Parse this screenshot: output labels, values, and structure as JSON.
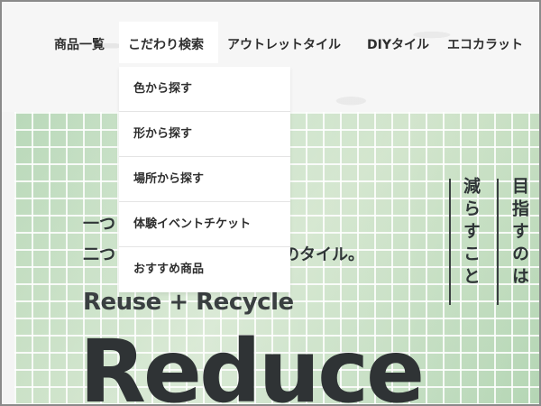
{
  "nav": {
    "items": [
      "商品一覧",
      "こだわり検索",
      "アウトレットタイル",
      "DIYタイル",
      "エコカラット"
    ]
  },
  "dropdown": {
    "items": [
      "色から探す",
      "形から探す",
      "場所から探す",
      "体験イベントチケット",
      "おすすめ商品"
    ]
  },
  "hero": {
    "line1": "一つ",
    "line2_start": "二つ",
    "line2_end": "のタイル。",
    "subtitle": "Reuse + Recycle",
    "title": "Reduce",
    "vertical_right": "目指すのは",
    "vertical_left": "減らすこと"
  }
}
